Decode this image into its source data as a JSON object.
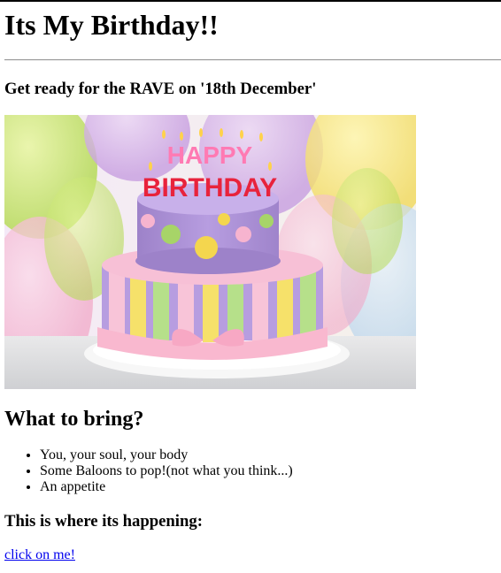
{
  "heading": "Its My Birthday!!",
  "tagline": "Get ready for the RAVE on '18th December'",
  "image": {
    "alt": "Birthday cake",
    "cake_text_line1": "HAPPY",
    "cake_text_line2": "BIRTHDAY"
  },
  "bring_section": {
    "title": "What to bring?",
    "items": [
      "You, your soul, your body",
      "Some Baloons to pop!(not what you think...)",
      "An appetite"
    ]
  },
  "location_section": {
    "title": "This is where its happening:",
    "link_text": "click on me!"
  },
  "colors": {
    "link": "#0000ee",
    "text": "#000000"
  }
}
